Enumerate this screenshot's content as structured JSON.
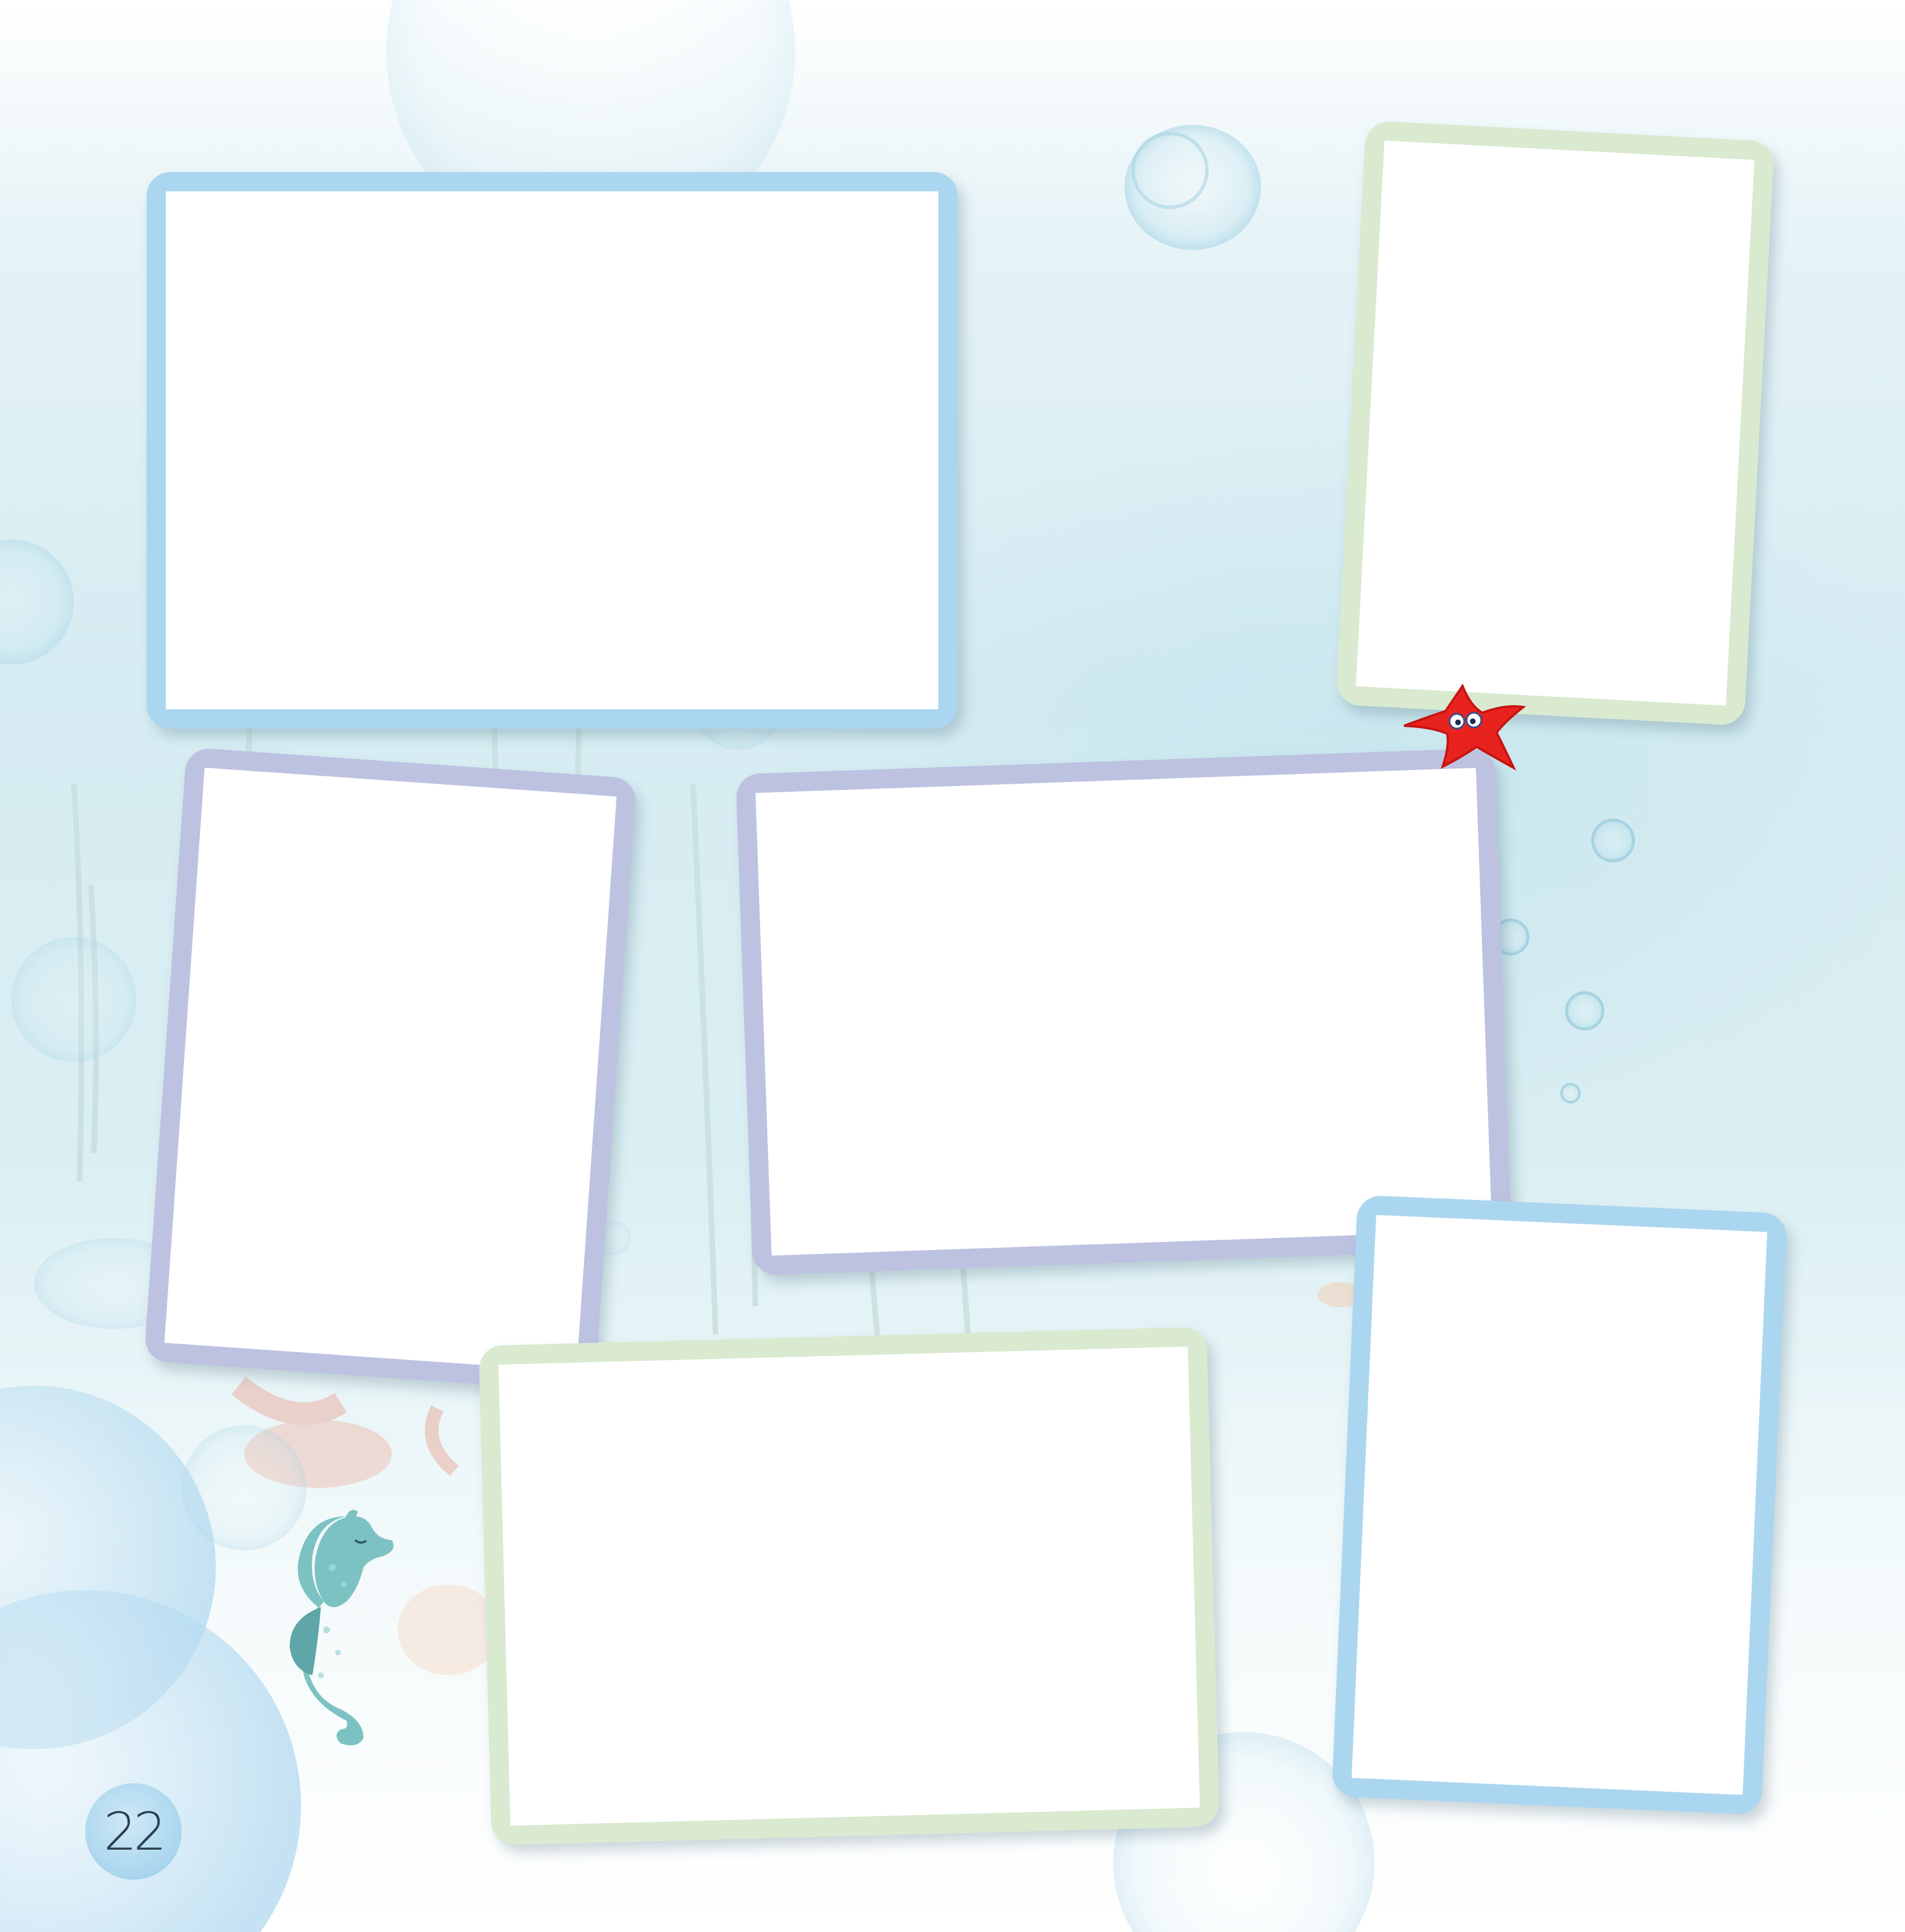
{
  "page": {
    "page_number": "22",
    "colors": {
      "frame_blue": "#abd6f0",
      "frame_green": "#d9ead0",
      "frame_purple": "#bdc2e1",
      "starfish": "#e8231e",
      "seahorse": "#7cc2c3"
    }
  },
  "photo_frames": [
    {
      "id": "frame-1",
      "shape": "landscape",
      "color": "blue"
    },
    {
      "id": "frame-2",
      "shape": "portrait",
      "color": "green"
    },
    {
      "id": "frame-3",
      "shape": "portrait",
      "color": "purple"
    },
    {
      "id": "frame-4",
      "shape": "landscape",
      "color": "purple"
    },
    {
      "id": "frame-5",
      "shape": "portrait",
      "color": "blue"
    },
    {
      "id": "frame-6",
      "shape": "landscape",
      "color": "green"
    }
  ],
  "decorations": [
    "bubbles",
    "seaweed",
    "starfish",
    "seahorse"
  ]
}
